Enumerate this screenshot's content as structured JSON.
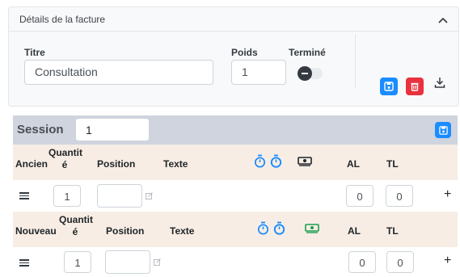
{
  "invoice": {
    "header_title": "Détails de la facture",
    "title_label": "Titre",
    "title_value": "Consultation",
    "weight_label": "Poids",
    "weight_value": "1",
    "done_label": "Terminé",
    "done_checked": false
  },
  "session": {
    "label": "Session",
    "value": "1"
  },
  "table_headers": {
    "old": "Ancien",
    "new": "Nouveau",
    "quantity_line1": "Quantit",
    "quantity_line2": "é",
    "position": "Position",
    "text": "Texte",
    "al": "AL",
    "tl": "TL"
  },
  "rows": [
    {
      "quantity": "1",
      "al": "0",
      "tl": "0"
    },
    {
      "quantity": "1",
      "al": "0",
      "tl": "0"
    }
  ],
  "colors": {
    "primary": "#1a8cff",
    "danger": "#e8323e",
    "money_old": "#212529",
    "money_new": "#1e9e50",
    "timer": "#1a8cff",
    "header_row": "#f7ede4",
    "session_bar": "#cfd4de"
  },
  "icons": [
    "chevron-up-icon",
    "save-icon",
    "trash-icon",
    "download-icon",
    "menu-icon",
    "stopwatch-icon",
    "money-icon",
    "external-link-icon",
    "plus-icon"
  ]
}
